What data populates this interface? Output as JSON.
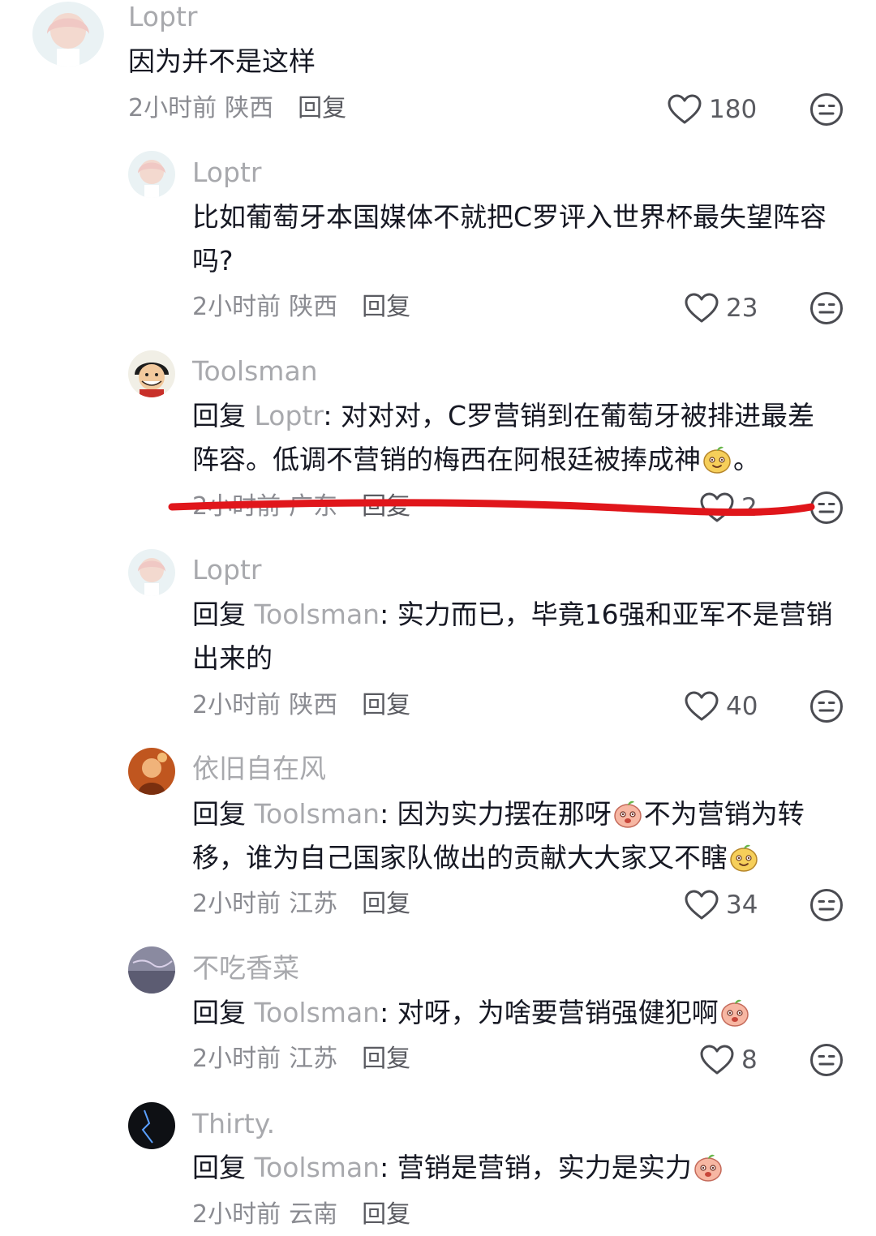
{
  "comments": [
    {
      "username": "Loptr",
      "reply_prefix": "",
      "reply_to": "",
      "reply_sep": "",
      "text": "因为并不是这样",
      "time": "2小时前",
      "location": "陕西",
      "reply_label": "回复",
      "likes": "180"
    },
    {
      "username": "Loptr",
      "reply_prefix": "",
      "reply_to": "",
      "reply_sep": "",
      "text": "比如葡萄牙本国媒体不就把C罗评入世界杯最失望阵容吗?",
      "time": "2小时前",
      "location": "陕西",
      "reply_label": "回复",
      "likes": "23"
    },
    {
      "username": "Toolsman",
      "reply_prefix": "回复",
      "reply_to": "Loptr",
      "reply_sep": ": ",
      "text": "对对对，C罗营销到在葡萄牙被排进最差阵容。低调不营销的梅西在阿根廷被捧成神",
      "text_end": "。",
      "time": "2小时前",
      "location": "广东",
      "reply_label": "回复",
      "likes": "2"
    },
    {
      "username": "Loptr",
      "reply_prefix": "回复",
      "reply_to": "Toolsman",
      "reply_sep": ": ",
      "text": "实力而已，毕竟16强和亚军不是营销出来的",
      "time": "2小时前",
      "location": "陕西",
      "reply_label": "回复",
      "likes": "40"
    },
    {
      "username": "依旧自在风",
      "reply_prefix": "回复",
      "reply_to": "Toolsman",
      "reply_sep": ": ",
      "text": "因为实力摆在那呀",
      "text_mid": "不为营销为转移，谁为自己国家队做出的贡献大大家又不瞎",
      "time": "2小时前",
      "location": "江苏",
      "reply_label": "回复",
      "likes": "34"
    },
    {
      "username": "不吃香菜",
      "reply_prefix": "回复",
      "reply_to": "Toolsman",
      "reply_sep": ": ",
      "text": "对呀，为啥要营销强健犯啊",
      "time": "2小时前",
      "location": "江苏",
      "reply_label": "回复",
      "likes": "8"
    },
    {
      "username": "Thirty.",
      "reply_prefix": "回复",
      "reply_to": "Toolsman",
      "reply_sep": ": ",
      "text": "营销是营销，实力是实力",
      "time": "2小时前",
      "location": "云南",
      "reply_label": "回复",
      "likes": ""
    }
  ],
  "icons": {
    "like": "heart-outline-icon",
    "dislike": "neutral-face-icon",
    "annotation": "red-underline-mark"
  },
  "colors": {
    "username": "#a8a9ad",
    "text": "#161823",
    "meta": "#8a8b91",
    "annotation": "#e0161b"
  }
}
